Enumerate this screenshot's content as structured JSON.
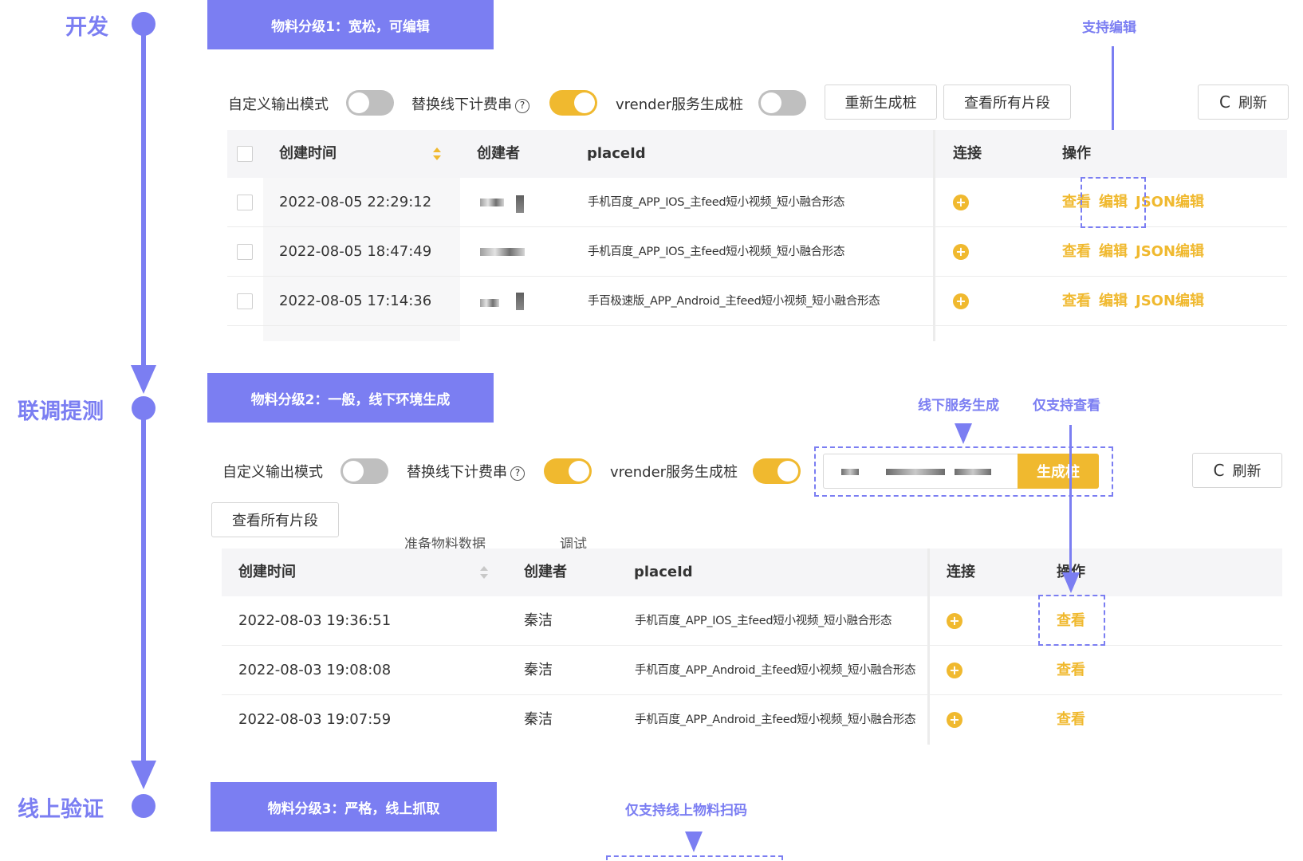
{
  "timeline": {
    "stages": [
      "开发",
      "联调提测",
      "线上验证"
    ]
  },
  "levels": [
    {
      "banner": "物料分级1：宽松，可编辑"
    },
    {
      "banner": "物料分级2：一般，线下环境生成"
    },
    {
      "banner": "物料分级3：严格，线上抓取"
    }
  ],
  "toolbar": {
    "custom_output": "自定义输出模式",
    "replace_billing": "替换线下计费串",
    "help_glyph": "?",
    "vrender": "vrender服务生成桩",
    "regen": "重新生成桩",
    "view_all": "查看所有片段",
    "refresh_glyph": "C",
    "refresh": "刷新",
    "generate": "生成桩"
  },
  "table_headers": {
    "created_time": "创建时间",
    "creator": "创建者",
    "placeid": "placeId",
    "connect": "连接",
    "actions": "操作"
  },
  "table1": {
    "rows": [
      {
        "time": "2022-08-05 22:29:12",
        "placeid": "手机百度_APP_IOS_主feed短小视频_短小融合形态"
      },
      {
        "time": "2022-08-05 18:47:49",
        "placeid": "手机百度_APP_IOS_主feed短小视频_短小融合形态"
      },
      {
        "time": "2022-08-05 17:14:36",
        "placeid": "手百极速版_APP_Android_主feed短小视频_短小融合形态"
      }
    ],
    "actions": {
      "view": "查看",
      "edit": "编辑",
      "json_edit": "JSON编辑"
    }
  },
  "table2": {
    "rows": [
      {
        "time": "2022-08-03 19:36:51",
        "creator": "秦洁",
        "placeid": "手机百度_APP_IOS_主feed短小视频_短小融合形态"
      },
      {
        "time": "2022-08-03 19:08:08",
        "creator": "秦洁",
        "placeid": "手机百度_APP_Android_主feed短小视频_短小融合形态"
      },
      {
        "time": "2022-08-03 19:07:59",
        "creator": "秦洁",
        "placeid": "手机百度_APP_Android_主feed短小视频_短小融合形态"
      }
    ],
    "actions": {
      "view": "查看"
    }
  },
  "connect_glyph": "+",
  "annotations": {
    "support_edit": "支持编辑",
    "offline_generate": "线下服务生成",
    "view_only": "仅支持查看",
    "online_scan_only": "仅支持线上物料扫码",
    "prepare_data": "准备物料数据",
    "debug": "调试"
  },
  "colors": {
    "annotation_purple": "#7b7ef2",
    "action_yellow": "#f0b92f",
    "switch_off_gray": "#bfbfbf"
  }
}
